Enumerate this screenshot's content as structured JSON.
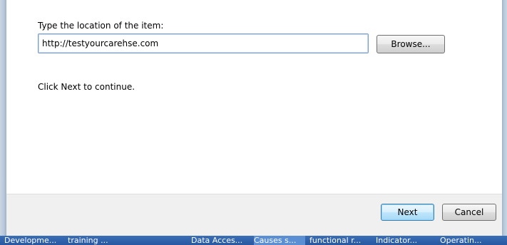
{
  "dialog": {
    "prompt_label": "Type the location of the item:",
    "location_value": "http://testyourcarehse.com",
    "browse_label": "Browse...",
    "continue_text": "Click Next to continue.",
    "next_label": "Next",
    "cancel_label": "Cancel"
  },
  "taskbar": {
    "items": [
      {
        "label": "Developme..."
      },
      {
        "label": "training ..."
      },
      {
        "label": "Data Acces..."
      },
      {
        "label": "Causes s..."
      },
      {
        "label": "functional r..."
      },
      {
        "label": "Indicator..."
      },
      {
        "label": "Operatin..."
      }
    ]
  },
  "colors": {
    "taskbar": "#2a5ca8",
    "focus_border": "#7a9cd3",
    "footer": "#f0f0f0"
  }
}
